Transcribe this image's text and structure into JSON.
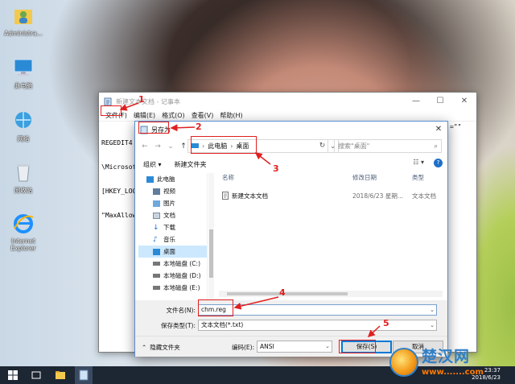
{
  "desktop": {
    "icons": [
      {
        "label": "Administra...",
        "icon": "user-folder-icon"
      },
      {
        "label": "此电脑",
        "icon": "computer-icon"
      },
      {
        "label": "网络",
        "icon": "network-icon"
      },
      {
        "label": "回收站",
        "icon": "recycle-bin-icon"
      },
      {
        "label": "Internet Explorer",
        "icon": "internet-explorer-icon"
      }
    ]
  },
  "notepad": {
    "title": "新建文本文档 - 记事本",
    "menu": [
      "文件(F)",
      "编辑(E)",
      "格式(O)",
      "查看(V)",
      "帮助(H)"
    ],
    "lines": [
      "REGEDIT4",
      "\\Microsof",
      "[HKEY_LOC",
      "\"MaxAllow"
    ],
    "right_fragment": "=\"\""
  },
  "dialog": {
    "title": "另存为",
    "address": {
      "root": "此电脑",
      "current": "桌面"
    },
    "search_placeholder": "搜索\"桌面\"",
    "toolbar": {
      "organize": "组织 ▾",
      "new_folder": "新建文件夹"
    },
    "nav_items": [
      {
        "label": "此电脑",
        "icon": "computer-icon"
      },
      {
        "label": "视频",
        "icon": "video-folder-icon"
      },
      {
        "label": "图片",
        "icon": "pictures-folder-icon"
      },
      {
        "label": "文档",
        "icon": "documents-folder-icon"
      },
      {
        "label": "下载",
        "icon": "download-icon"
      },
      {
        "label": "音乐",
        "icon": "music-icon"
      },
      {
        "label": "桌面",
        "icon": "desktop-folder-icon",
        "selected": true
      },
      {
        "label": "本地磁盘 (C:)",
        "icon": "drive-icon"
      },
      {
        "label": "本地磁盘 (D:)",
        "icon": "drive-icon"
      },
      {
        "label": "本地磁盘 (E:)",
        "icon": "drive-icon"
      }
    ],
    "columns": [
      "名称",
      "修改日期",
      "类型"
    ],
    "files": [
      {
        "name": "新建文本文档",
        "date": "2018/6/23 星期...",
        "type": "文本文档"
      }
    ],
    "filename_label": "文件名(N):",
    "filename_value": "chm.reg",
    "filetype_label": "保存类型(T):",
    "filetype_value": "文本文档(*.txt)",
    "hide_folders": "隐藏文件夹",
    "encoding_label": "编码(E):",
    "encoding_value": "ANSI",
    "save_button": "保存(S)",
    "cancel_button": "取消"
  },
  "annotations": [
    "1",
    "2",
    "3",
    "4",
    "5"
  ],
  "taskbar": {
    "time": "23:37",
    "date": "2018/6/23"
  },
  "watermark": {
    "title": "楚汉网",
    "url": "www.......com"
  }
}
